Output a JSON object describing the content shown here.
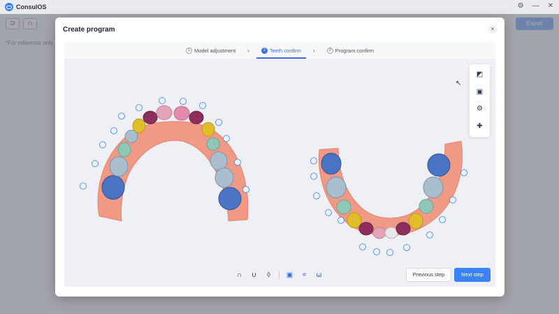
{
  "app": {
    "title": "ConsulOS"
  },
  "background": {
    "reference_note": "*For reference only",
    "action_label": "Export"
  },
  "modal": {
    "title": "Create program",
    "close": "×",
    "steps": [
      {
        "num": "1",
        "label": "Model adjustment"
      },
      {
        "num": "2",
        "label": "Teeth confirm"
      },
      {
        "num": "3",
        "label": "Program confirm"
      }
    ],
    "active_step": 2,
    "buttons": {
      "previous": "Previous step",
      "next": "Next step"
    }
  },
  "colors": {
    "accent": "#3b82f6",
    "gum": "#f0917c",
    "tooth_blue": "#4a74c4",
    "tooth_light_blue": "#a9bfcf",
    "tooth_teal": "#8fc7b8",
    "tooth_yellow": "#e2bd2a",
    "tooth_maroon": "#8e2e5c",
    "tooth_pink": "#e3a4b8"
  },
  "icons": {
    "side_tools": [
      "edit-box-icon",
      "comment-icon",
      "tooth-settings-icon",
      "tooth-add-icon"
    ],
    "bottom_tools": [
      "upper-arch-icon",
      "lower-arch-icon",
      "both-arch-icon",
      "monitor-icon",
      "fit-view-icon",
      "tooth-icon"
    ]
  }
}
